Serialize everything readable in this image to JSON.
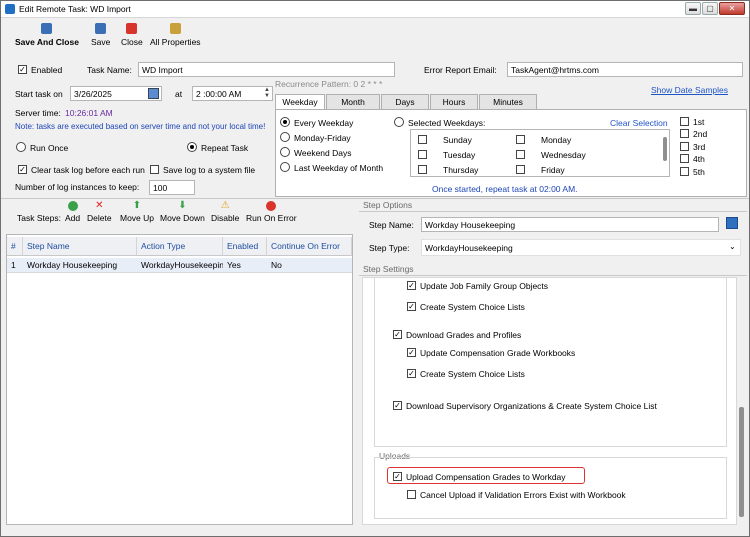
{
  "window": {
    "title": "Edit Remote Task: WD Import"
  },
  "toolbar": {
    "save_and_close": "Save And Close",
    "save": "Save",
    "close": "Close",
    "all_properties": "All Properties"
  },
  "general": {
    "enabled_label": "Enabled",
    "enabled": true,
    "task_name_label": "Task Name:",
    "task_name": "WD Import",
    "error_email_label": "Error Report Email:",
    "error_email": "TaskAgent@hrtms.com",
    "start_task_label": "Start task on",
    "start_date": "3/26/2025",
    "at_label": "at",
    "start_time": "2 :00:00 AM",
    "server_time_label": "Server time:",
    "server_time": "10:26:01 AM",
    "note": "Note: tasks are executed based on server time and not your local time!",
    "run_once": "Run Once",
    "repeat_task": "Repeat Task",
    "clear_log": "Clear task log before each run",
    "save_log": "Save log to a system file",
    "log_instances_label": "Number of log instances to keep:",
    "log_instances": "100"
  },
  "recurrence": {
    "pattern_label": "Recurrence Pattern: 0 2 * * *",
    "show_samples": "Show Date Samples",
    "tabs": [
      "Weekday",
      "Month",
      "Days",
      "Hours",
      "Minutes"
    ],
    "options": [
      "Every Weekday",
      "Monday-Friday",
      "Weekend Days",
      "Last Weekday of Month"
    ],
    "selected_weekdays": "Selected Weekdays:",
    "clear_selection": "Clear Selection",
    "days_col1": [
      "Sunday",
      "Tuesday",
      "Thursday"
    ],
    "days_col2": [
      "Monday",
      "Wednesday",
      "Friday"
    ],
    "weeks": [
      "1st",
      "2nd",
      "3rd",
      "4th",
      "5th"
    ],
    "summary": "Once started, repeat task at 02:00 AM."
  },
  "steps": {
    "label": "Task Steps:",
    "buttons": [
      "Add",
      "Delete",
      "Move Up",
      "Move Down",
      "Disable",
      "Run On Error"
    ],
    "columns": [
      "#",
      "Step Name",
      "Action Type",
      "Enabled",
      "Continue On Error"
    ],
    "rows": [
      {
        "num": "1",
        "name": "Workday Housekeeping",
        "action": "WorkdayHousekeeping",
        "enabled": "Yes",
        "continue": "No"
      }
    ]
  },
  "step_options": {
    "header": "Step Options",
    "name_label": "Step Name:",
    "name": "Workday Housekeeping",
    "type_label": "Step Type:",
    "type": "WorkdayHousekeeping"
  },
  "step_settings": {
    "header": "Step Settings",
    "items": [
      "Update Job Family Group Objects",
      "Create System Choice Lists",
      "Download Grades and Profiles",
      "Update Compensation Grade Workbooks",
      "Create System Choice Lists",
      "Download Supervisory Organizations & Create System Choice List"
    ],
    "uploads_header": "Uploads",
    "upload_grades": "Upload Compensation Grades to Workday",
    "cancel_upload": "Cancel Upload if Validation Errors Exist with Workbook"
  },
  "colors": {
    "accent": "#1e55c8",
    "highlight": "#e03030",
    "note": "#1e45b8"
  }
}
